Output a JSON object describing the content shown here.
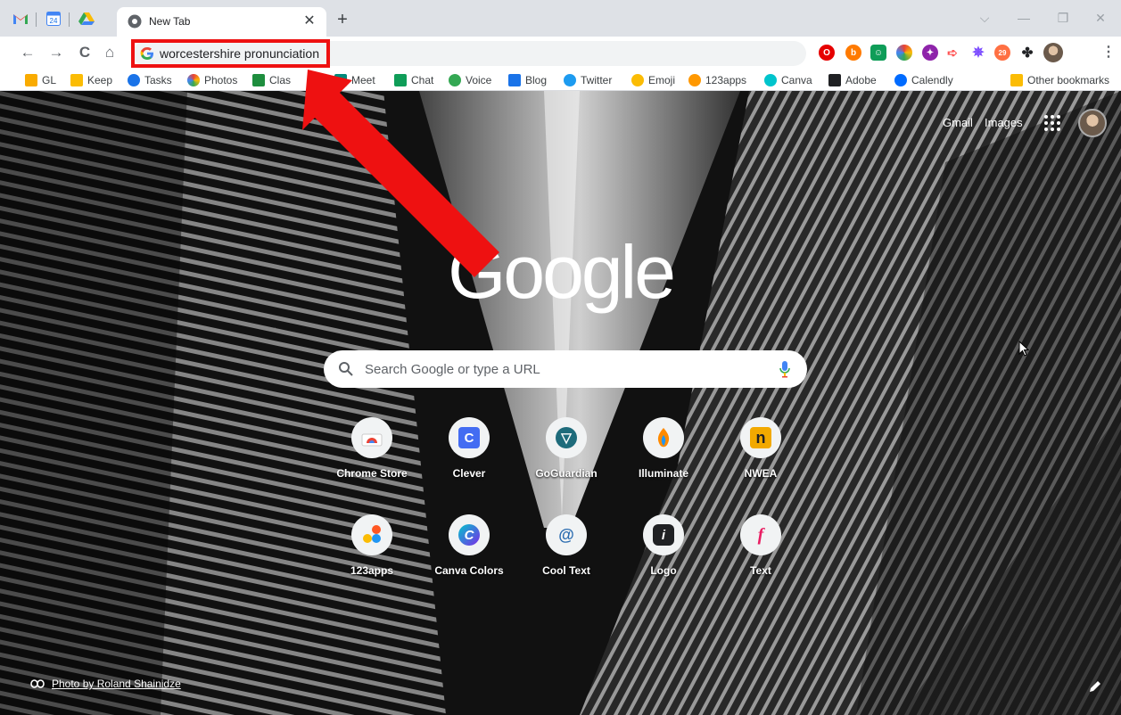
{
  "browser": {
    "active_tab": {
      "title": "New Tab",
      "close_glyph": "✕"
    },
    "new_tab_glyph": "+",
    "pinned_tabs": [
      {
        "name": "gmail-icon"
      },
      {
        "name": "calendar-icon",
        "label": "24"
      },
      {
        "name": "drive-icon"
      }
    ],
    "window_controls": {
      "dropdown": "⌵",
      "minimize": "—",
      "maximize": "❐",
      "close": "✕"
    },
    "nav": {
      "back": "←",
      "forward": "→",
      "reload": "C",
      "home": "⌂"
    },
    "omnibox": {
      "value": "worcestershire pronunciation"
    },
    "menu_glyph": "⋮"
  },
  "bookmarks": [
    {
      "label": "GL",
      "color": "#f9ab00"
    },
    {
      "label": "Keep",
      "color": "#fbbc04"
    },
    {
      "label": "Tasks",
      "color": "#1a73e8"
    },
    {
      "label": "Photos",
      "color": "#34a853"
    },
    {
      "label": "Clas",
      "color": "#1e8e3e"
    },
    {
      "label": "Meet",
      "color": "#00897b"
    },
    {
      "label": "Chat",
      "color": "#0f9d58"
    },
    {
      "label": "Voice",
      "color": "#34a853"
    },
    {
      "label": "Blog",
      "color": "#1a73e8"
    },
    {
      "label": "Twitter",
      "color": "#1d9bf0"
    },
    {
      "label": "Emoji",
      "color": "#fbbc04"
    },
    {
      "label": "123apps",
      "color": "#ff9800"
    },
    {
      "label": "Canva",
      "color": "#00c4cc"
    },
    {
      "label": "Adobe",
      "color": "#202124"
    },
    {
      "label": "Calendly",
      "color": "#006bff"
    }
  ],
  "other_bookmarks": "Other bookmarks",
  "ntp": {
    "top_links": {
      "gmail": "Gmail",
      "images": "Images"
    },
    "logo_text": "Google",
    "search_placeholder": "Search Google or type a URL",
    "shortcuts": [
      {
        "label": "Chrome Store",
        "icon": "chrome-store-icon",
        "color": "#ea4335",
        "glyph": ""
      },
      {
        "label": "Clever",
        "icon": "clever-icon",
        "color": "#436cf2",
        "glyph": "C"
      },
      {
        "label": "GoGuardian",
        "icon": "goguardian-icon",
        "color": "#1e6b7b",
        "glyph": "▽"
      },
      {
        "label": "Illuminate",
        "icon": "illuminate-icon",
        "color": "#ff8a00",
        "glyph": ""
      },
      {
        "label": "NWEA",
        "icon": "nwea-icon",
        "color": "#f2a900",
        "glyph": "n"
      },
      {
        "label": "123apps",
        "icon": "apps123-icon",
        "color": "#ff5722",
        "glyph": ""
      },
      {
        "label": "Canva Colors",
        "icon": "canva-colors-icon",
        "color": "#7d2ae8",
        "glyph": "C"
      },
      {
        "label": "Cool Text",
        "icon": "cool-text-icon",
        "color": "#2b6cb0",
        "glyph": "@"
      },
      {
        "label": "Logo",
        "icon": "logo-icon",
        "color": "#202124",
        "glyph": "i"
      },
      {
        "label": "Text",
        "icon": "text-icon",
        "color": "#e91e63",
        "glyph": "f"
      }
    ],
    "photo_credit": "Photo by Roland Shainidze"
  }
}
